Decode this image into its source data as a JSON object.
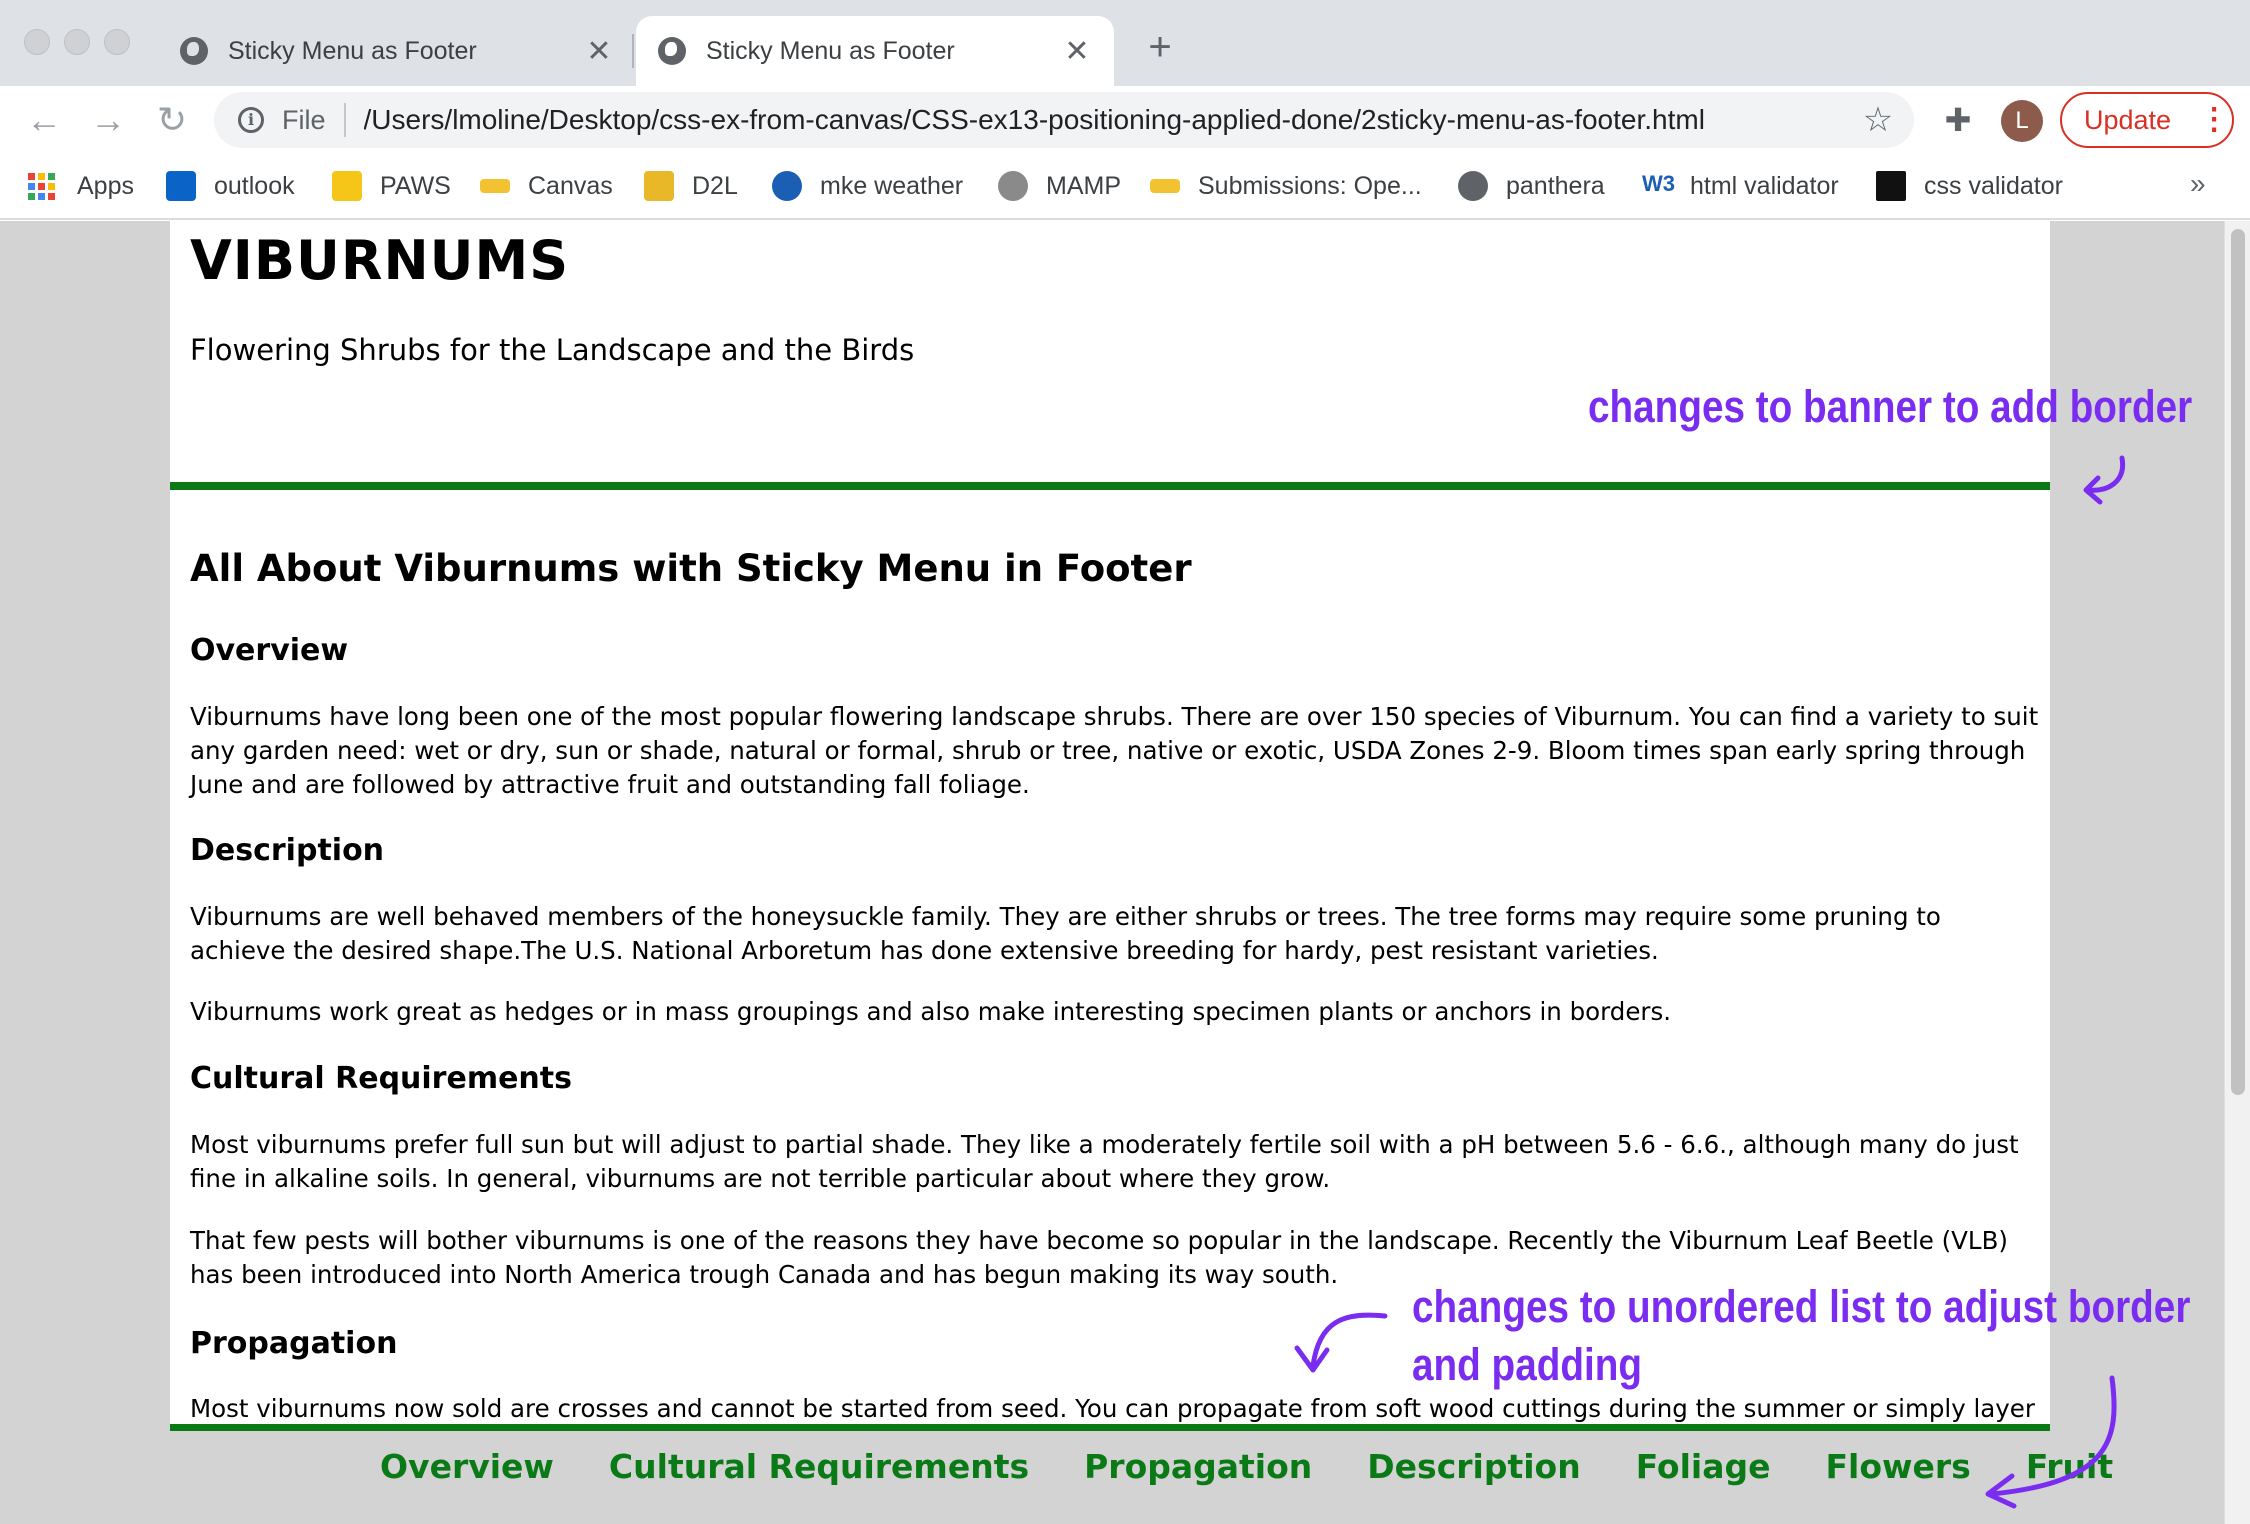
{
  "browser": {
    "tabs": [
      {
        "title": "Sticky Menu as Footer",
        "close": "✕"
      },
      {
        "title": "Sticky Menu as Footer",
        "close": "✕"
      }
    ],
    "new_tab": "+",
    "file_label": "File",
    "url": "/Users/lmoline/Desktop/css-ex-from-canvas/CSS-ex13-positioning-applied-done/2sticky-menu-as-footer.html",
    "avatar_letter": "L",
    "update_label": "Update",
    "bookmarks": [
      {
        "label": "Apps"
      },
      {
        "label": "outlook"
      },
      {
        "label": "PAWS"
      },
      {
        "label": "Canvas"
      },
      {
        "label": "D2L"
      },
      {
        "label": "mke weather"
      },
      {
        "label": "MAMP"
      },
      {
        "label": "Submissions: Ope..."
      },
      {
        "label": "panthera"
      },
      {
        "label": "html validator"
      },
      {
        "label": "css validator"
      }
    ],
    "more_bookmarks": "»"
  },
  "page": {
    "site_title": "VIBURNUMS",
    "tagline": "Flowering Shrubs for the Landscape and the Birds",
    "main_title": "All About Viburnums with Sticky Menu in Footer",
    "sections": {
      "overview_heading": "Overview",
      "overview_p1": "Viburnums have long been one of the most popular flowering landscape shrubs. There are over 150 species of Viburnum. You can find a variety to suit any garden need: wet or dry, sun or shade, natural or formal, shrub or tree, native or exotic, USDA Zones 2-9. Bloom times span early spring through June and are followed by attractive fruit and outstanding fall foliage.",
      "description_heading": "Description",
      "description_p1": "Viburnums are well behaved members of the honeysuckle family. They are either shrubs or trees. The tree forms may require some pruning to achieve the desired shape.The U.S. National Arboretum has done extensive breeding for hardy, pest resistant varieties.",
      "description_p2": "Viburnums work great as hedges or in mass groupings and also make interesting specimen plants or anchors in borders.",
      "cultural_heading": "Cultural Requirements",
      "cultural_p1": "Most viburnums prefer full sun but will adjust to partial shade. They like a moderately fertile soil with a pH between 5.6 - 6.6., although many do just fine in alkaline soils. In general, viburnums are not terrible particular about where they grow.",
      "cultural_p2": "That few pests will bother viburnums is one of the reasons they have become so popular in the landscape. Recently the Viburnum Leaf Beetle (VLB) has been introduced into North America trough Canada and has begun making its way south.",
      "propagation_heading": "Propagation",
      "propagation_p1": "Most viburnums now sold are crosses and cannot be started from seed. You can propagate from soft wood cuttings during the summer or simply layer branches in"
    },
    "footer_menu": [
      "Overview",
      "Cultural Requirements",
      "Propagation",
      "Description",
      "Foliage",
      "Flowers",
      "Fruit"
    ]
  },
  "annotations": {
    "banner_note": "changes to banner to add border",
    "list_note_line1": "changes to unordered list to adjust border",
    "list_note_line2": "and padding"
  },
  "colors": {
    "accent_green": "#0a7a17",
    "annotation_purple": "#7a2df0",
    "page_background": "#d3d3d3"
  }
}
